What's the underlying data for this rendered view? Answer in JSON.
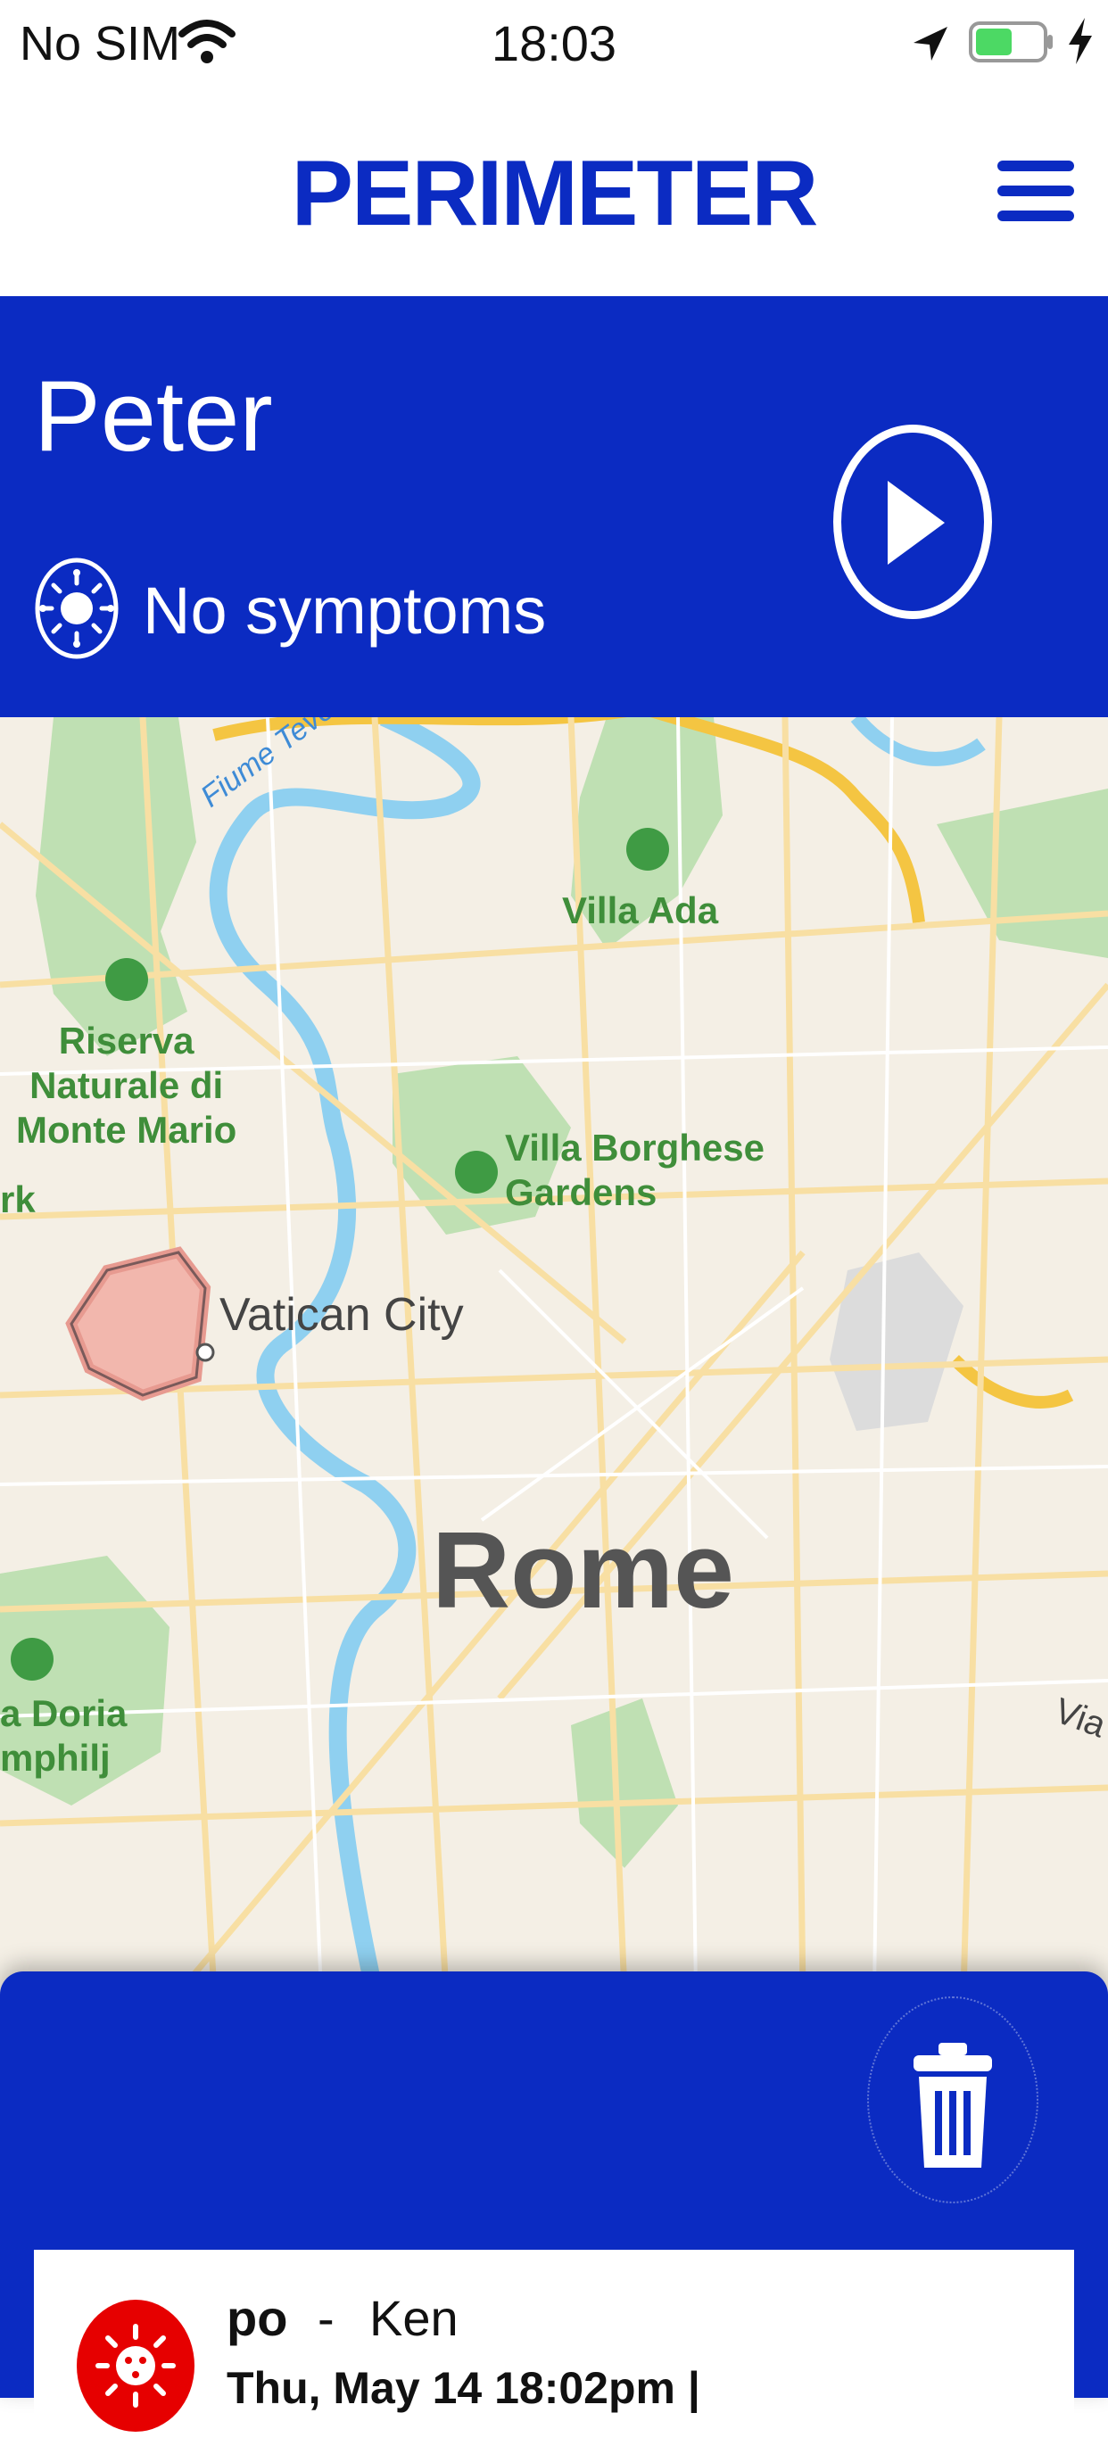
{
  "status_bar": {
    "carrier": "No SIM",
    "time": "18:03",
    "icons": [
      "wifi-icon",
      "location-arrow-icon",
      "battery-icon",
      "charging-bolt-icon"
    ]
  },
  "header": {
    "title": "PERIMETER",
    "menu_icon": "hamburger-menu-icon"
  },
  "profile": {
    "name": "Peter",
    "symptoms_icon": "virus-icon",
    "symptoms": "No symptoms",
    "play_icon": "play-icon"
  },
  "map": {
    "places": {
      "tevere": "Fiume Tevere",
      "villa_ada": "Villa Ada",
      "riserva": "Riserva\nNaturale di\nMonte Mario",
      "villa_borghese": "Villa Borghese\nGardens",
      "vatican": "Vatican City",
      "rome": "Rome",
      "doria": "a Doria\nmphilj",
      "rk": "rk",
      "via": "Via"
    }
  },
  "bottom_sheet": {
    "trash_icon": "trash-icon",
    "reports": [
      {
        "name": "po",
        "separator": "-",
        "contact": "Ken",
        "datetime": "Thu, May 14 18:02pm |",
        "icon": "virus-icon"
      }
    ]
  },
  "colors": {
    "brand_blue": "#0b2bc2",
    "alert_red": "#e60000",
    "park_green": "#3f8e3a",
    "river_blue": "#8fd0f0"
  }
}
